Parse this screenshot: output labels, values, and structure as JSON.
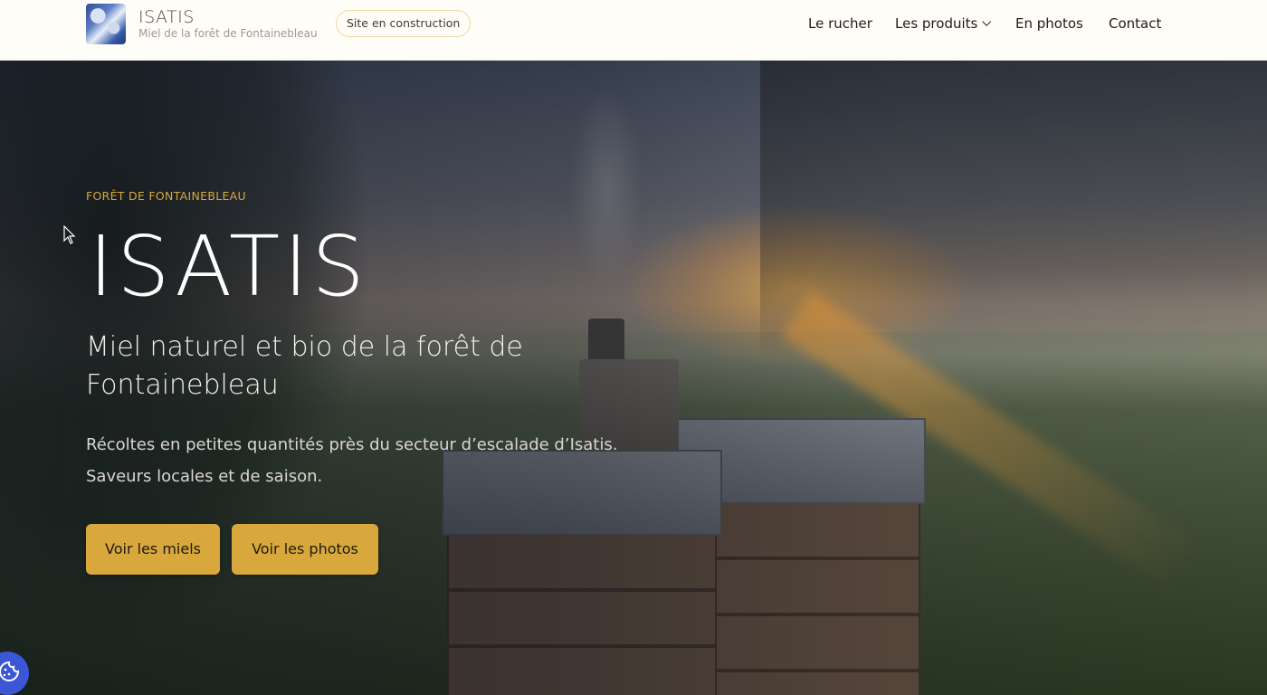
{
  "header": {
    "brand_name": "ISATIS",
    "brand_tagline": "Miel de la forêt de Fontainebleau",
    "badge": "Site en construction",
    "nav": {
      "rucher": "Le rucher",
      "produits": "Les produits",
      "photos": "En photos",
      "contact": "Contact"
    }
  },
  "hero": {
    "eyebrow": "FORÊT DE FONTAINEBLEAU",
    "title": "ISATIS",
    "subtitle": "Miel naturel et bio de la forêt de Fontainebleau",
    "description_line1": "Récoltes en petites quantités près du secteur d’escalade d’Isatis.",
    "description_line2": "Saveurs locales et de saison.",
    "button_miels": "Voir les miels",
    "button_photos": "Voir les photos"
  },
  "colors": {
    "accent": "#d9a83c",
    "eyebrow": "#d8a93b",
    "cookie_button": "#3b57d6"
  },
  "icons": {
    "logo": "honey-jar-logo",
    "dropdown": "chevron-down-icon",
    "cookie": "cookie-icon",
    "cursor": "mouse-pointer"
  }
}
